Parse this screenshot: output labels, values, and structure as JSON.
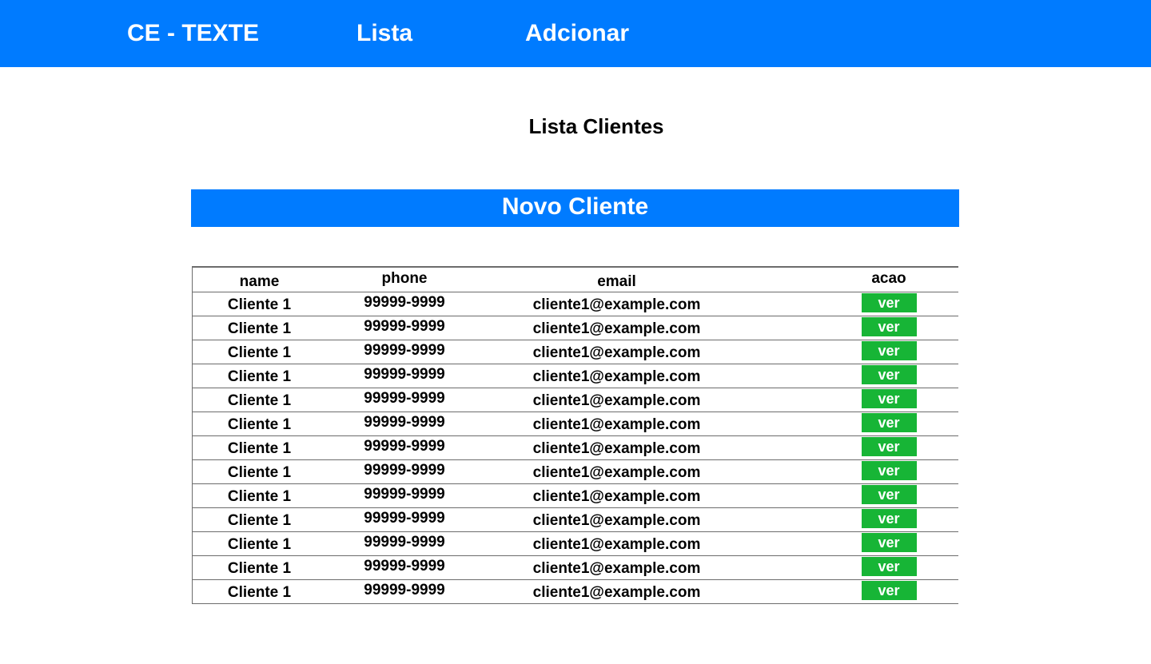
{
  "nav": {
    "brand": "CE - TEXTE",
    "lista": "Lista",
    "adicionar": "Adcionar"
  },
  "page": {
    "title": "Lista Clientes",
    "new_button": "Novo Cliente"
  },
  "table": {
    "headers": [
      "name",
      "phone",
      "email",
      "acao"
    ],
    "rows": [
      {
        "name": "Cliente 1",
        "phone": "99999-9999",
        "email": "cliente1@example.com",
        "action": "ver"
      },
      {
        "name": "Cliente 1",
        "phone": "99999-9999",
        "email": "cliente1@example.com",
        "action": "ver"
      },
      {
        "name": "Cliente 1",
        "phone": "99999-9999",
        "email": "cliente1@example.com",
        "action": "ver"
      },
      {
        "name": "Cliente 1",
        "phone": "99999-9999",
        "email": "cliente1@example.com",
        "action": "ver"
      },
      {
        "name": "Cliente 1",
        "phone": "99999-9999",
        "email": "cliente1@example.com",
        "action": "ver"
      },
      {
        "name": "Cliente 1",
        "phone": "99999-9999",
        "email": "cliente1@example.com",
        "action": "ver"
      },
      {
        "name": "Cliente 1",
        "phone": "99999-9999",
        "email": "cliente1@example.com",
        "action": "ver"
      },
      {
        "name": "Cliente 1",
        "phone": "99999-9999",
        "email": "cliente1@example.com",
        "action": "ver"
      },
      {
        "name": "Cliente 1",
        "phone": "99999-9999",
        "email": "cliente1@example.com",
        "action": "ver"
      },
      {
        "name": "Cliente 1",
        "phone": "99999-9999",
        "email": "cliente1@example.com",
        "action": "ver"
      },
      {
        "name": "Cliente 1",
        "phone": "99999-9999",
        "email": "cliente1@example.com",
        "action": "ver"
      },
      {
        "name": "Cliente 1",
        "phone": "99999-9999",
        "email": "cliente1@example.com",
        "action": "ver"
      },
      {
        "name": "Cliente 1",
        "phone": "99999-9999",
        "email": "cliente1@example.com",
        "action": "ver"
      }
    ]
  },
  "colors": {
    "primary": "#007bff",
    "action_green": "#17b536",
    "border": "#6c6c6c"
  }
}
